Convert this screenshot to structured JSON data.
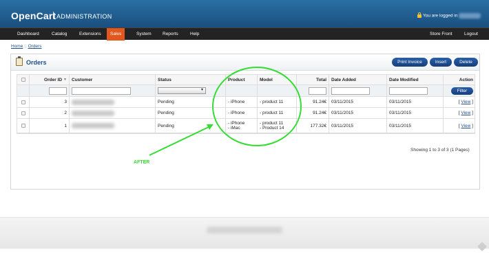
{
  "header": {
    "brand": "OpenCart",
    "separator": "|",
    "subtitle": "ADMINISTRATION",
    "login_text": "You are logged in"
  },
  "menu": {
    "items": [
      "Dashboard",
      "Catalog",
      "Extensions",
      "Sales",
      "System",
      "Reports",
      "Help"
    ],
    "active": "Sales",
    "store_front": "Store Front",
    "logout": "Logout"
  },
  "breadcrumb": {
    "home": "Home",
    "sep": "::",
    "current": "Orders"
  },
  "panel": {
    "title": "Orders",
    "buttons": {
      "print_invoice": "Print Invoice",
      "insert": "Insert",
      "delete": "Delete"
    }
  },
  "table": {
    "columns": {
      "order_id": "Order ID",
      "customer": "Customer",
      "status": "Status",
      "product": "Product",
      "model": "Model",
      "total": "Total",
      "date_added": "Date Added",
      "date_modified": "Date Modified",
      "action": "Action"
    },
    "filter_button": "Filter",
    "rows": [
      {
        "order_id": "3",
        "status": "Pending",
        "product_1": "- iPhone",
        "product_2": "",
        "model_1": "- product 11",
        "model_2": "",
        "total": "91.24€",
        "date_added": "03/11/2015",
        "date_modified": "03/11/2015",
        "action": "View"
      },
      {
        "order_id": "2",
        "status": "Pending",
        "product_1": "- iPhone",
        "product_2": "",
        "model_1": "- product 11",
        "model_2": "",
        "total": "91.24€",
        "date_added": "03/11/2015",
        "date_modified": "03/11/2015",
        "action": "View"
      },
      {
        "order_id": "1",
        "status": "Pending",
        "product_1": "- iPhone",
        "product_2": "- iMac",
        "model_1": "- product 11",
        "model_2": "- Product 14",
        "total": "177.32€",
        "date_added": "03/11/2015",
        "date_modified": "03/11/2015",
        "action": "View"
      }
    ]
  },
  "pagination": {
    "showing": "Showing 1 to 3 of 3 (1 Pages)"
  },
  "annotation": {
    "label": "AFTER",
    "color": "#33dd33"
  },
  "colors": {
    "header_blue": "#1a4f7e",
    "menu_active": "#e2571e",
    "button_blue": "#1e4e8c"
  }
}
